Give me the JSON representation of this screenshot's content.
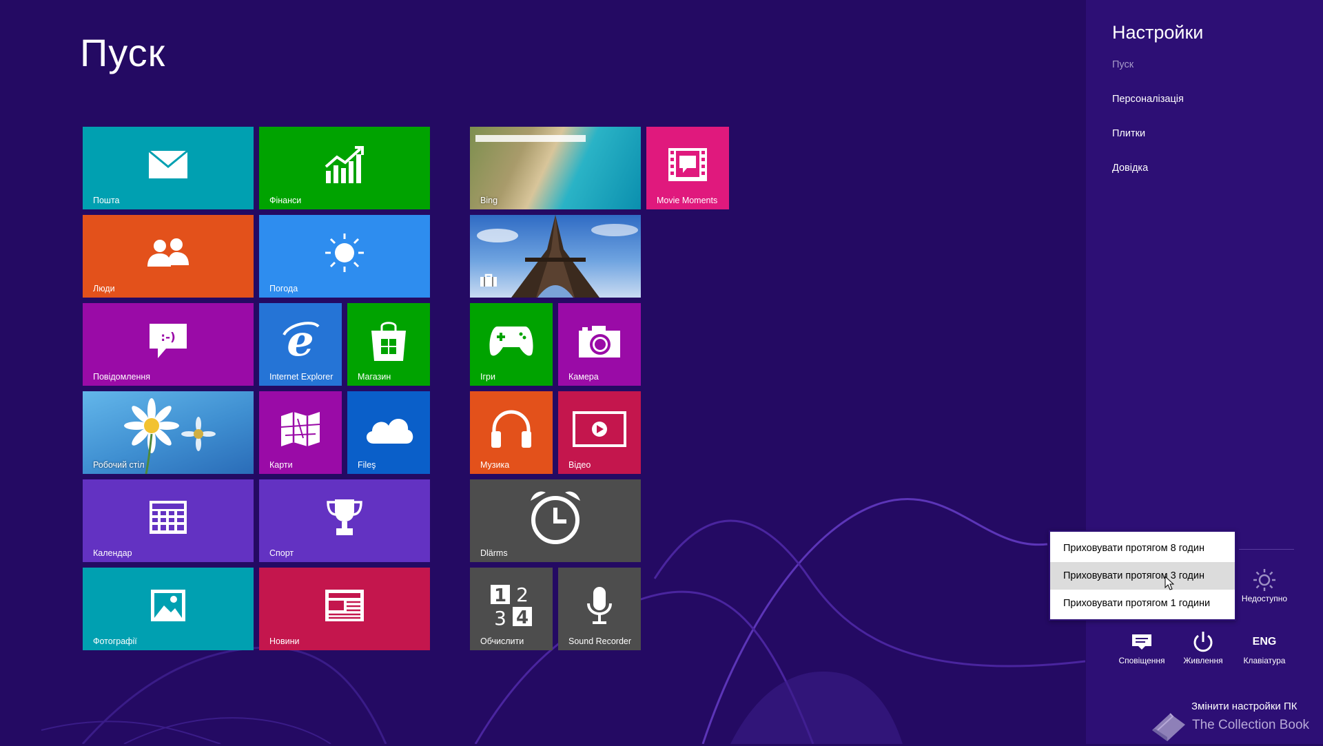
{
  "start": {
    "title": "Пуск",
    "tiles": {
      "mail": "Пошта",
      "finance": "Фінанси",
      "bing": "Bing",
      "movie_moments": "Movie Moments",
      "people": "Люди",
      "weather": "Погода",
      "messaging": "Повідомлення",
      "internet_explorer": "Internet Explorer",
      "store": "Магазин",
      "games": "Ігри",
      "camera": "Камера",
      "desktop": "Робочий стіл",
      "maps": "Карти",
      "files": "Filеş",
      "music": "Музика",
      "video": "Відео",
      "calendar": "Календар",
      "sport": "Спорт",
      "alarms": "Dlärms",
      "photos": "Фотографії",
      "news": "Новини",
      "calculator": "Обчислити",
      "sound_recorder": "Sound Recorder"
    }
  },
  "tile_colors": {
    "mail": "#00a0b1",
    "finance": "#00a300",
    "movie": "#e0197d",
    "people": "#e3511b",
    "weather": "#2e8def",
    "messaging": "#9a0ba7",
    "ie": "#2574d6",
    "store": "#00a300",
    "games": "#00a300",
    "camera": "#9a0ba7",
    "maps": "#9a0ba7",
    "files": "#0a5fc9",
    "music": "#e3511b",
    "video": "#c4164d",
    "calendar": "#6332c2",
    "sport": "#6332c2",
    "alarms": "#4d4d4d",
    "photos": "#00a0b1",
    "news": "#c4164d",
    "calculator": "#4d4d4d",
    "sound_recorder": "#4d4d4d"
  },
  "settings": {
    "title": "Настройки",
    "links": [
      "Пуск",
      "Персоналізація",
      "Плитки",
      "Довідка"
    ],
    "brightness_label": "Недоступно",
    "notifications_label": "Сповіщення",
    "power_label": "Живлення",
    "keyboard_code": "ENG",
    "keyboard_label": "Клавіатура",
    "change_pc_settings": "Змінити настройки ПК",
    "watermark": "The Collection Book"
  },
  "context_menu": {
    "items": [
      "Приховувати протягом 8 годин",
      "Приховувати протягом 3 годин",
      "Приховувати протягом 1 години"
    ],
    "hovered_index": 1
  },
  "icons": {
    "mail": "envelope-icon",
    "finance": "stock-chart-icon",
    "people": "people-icon",
    "weather": "sun-icon",
    "messaging": "chat-bubble-icon",
    "ie": "internet-explorer-icon",
    "store": "shopping-bag-icon",
    "games": "gamepad-icon",
    "camera": "camera-icon",
    "maps": "map-icon",
    "files": "cloud-icon",
    "music": "headphones-icon",
    "video": "play-icon",
    "calendar": "calendar-icon",
    "sport": "trophy-icon",
    "alarms": "alarm-clock-icon",
    "photos": "picture-icon",
    "news": "newspaper-icon",
    "calculator": "calculator-icon",
    "sound_recorder": "microphone-icon"
  }
}
